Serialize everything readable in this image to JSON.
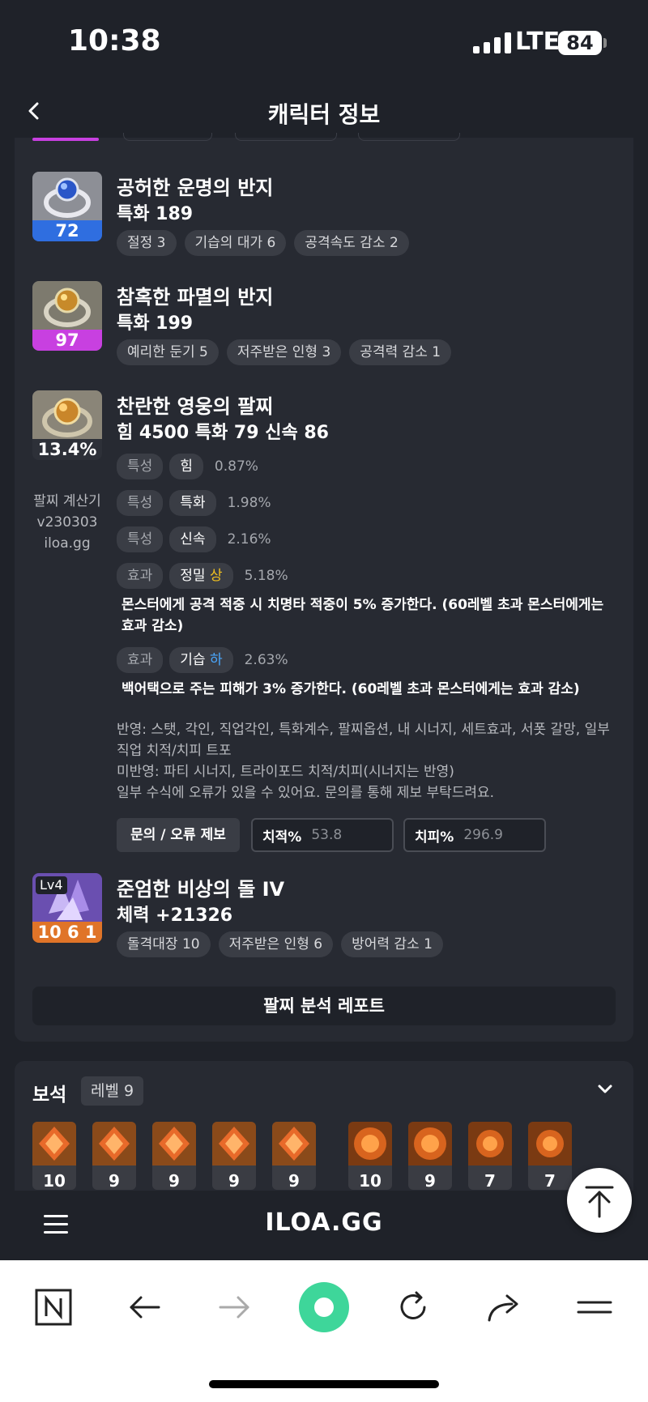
{
  "status_bar": {
    "time": "10:38",
    "network": "LTE",
    "battery": "84"
  },
  "header": {
    "title": "캐릭터 정보"
  },
  "items": [
    {
      "name": "공허한 운명의 반지",
      "stat": "특화 189",
      "level": "72",
      "level_color": "#2f6ee0",
      "tags": [
        "절정 3",
        "기습의 대가 6",
        "공격속도 감소 2"
      ]
    },
    {
      "name": "참혹한 파멸의 반지",
      "stat": "특화 199",
      "level": "97",
      "level_color": "#c840e0",
      "tags": [
        "예리한 둔기 5",
        "저주받은 인형 3",
        "공격력 감소 1"
      ]
    }
  ],
  "bracelet": {
    "name": "찬란한 영웅의 팔찌",
    "stat": "힘 4500  특화 79  신속 86",
    "percent": "13.4%",
    "calc_lines": [
      "팔찌 계산기",
      "v230303",
      "iloa.gg"
    ],
    "options": [
      {
        "type": "특성",
        "label": "힘",
        "grade": "",
        "value": "0.87%"
      },
      {
        "type": "특성",
        "label": "특화",
        "grade": "",
        "value": "1.98%"
      },
      {
        "type": "특성",
        "label": "신속",
        "grade": "",
        "value": "2.16%"
      },
      {
        "type": "효과",
        "label": "정밀",
        "grade": "상",
        "value": "5.18%"
      },
      {
        "type": "효과",
        "label": "기습",
        "grade": "하",
        "value": "2.63%"
      }
    ],
    "desc_precision": "몬스터에게 공격 적중 시 치명타 적중이 5% 증가한다. (60레벨 초과 몬스터에게는 효과 감소)",
    "desc_ambush": "백어택으로 주는 피해가 3% 증가한다. (60레벨 초과 몬스터에게는 효과 감소)",
    "note_lines": [
      "반영: 스탯, 각인, 직업각인, 특화계수, 팔찌옵션, 내 시너지, 세트효과, 서폿 갈망, 일부 직업 치적/치피 트포",
      "미반영: 파티 시너지, 트라이포드 치적/치피(시너지는 반영)",
      "일부 수식에 오류가 있을 수 있어요. 문의를 통해 제보 부탁드려요."
    ],
    "report_button": "문의 / 오류 제보",
    "crit_rate_label": "치적%",
    "crit_rate_value": "53.8",
    "crit_dmg_label": "치피%",
    "crit_dmg_value": "296.9"
  },
  "stone": {
    "name": "준엄한 비상의 돌 IV",
    "stat": "체력 +21326",
    "badge": "Lv4",
    "level": "10 6 1",
    "level_color": "#e07428",
    "tags": [
      "돌격대장 10",
      "저주받은 인형 6",
      "방어력 감소 1"
    ]
  },
  "analysis_button": "팔찌 분석 레포트",
  "gems": {
    "title": "보석",
    "level": "레벨 9",
    "values": [
      "10",
      "9",
      "9",
      "9",
      "9",
      "10",
      "9",
      "7",
      "7"
    ]
  },
  "site": {
    "logo": "ILOA.GG"
  }
}
